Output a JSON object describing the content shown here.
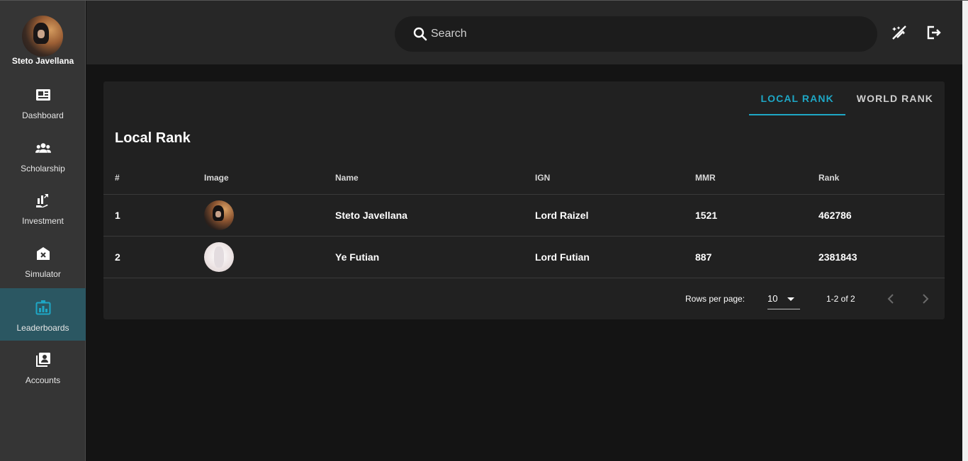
{
  "user": {
    "name": "Steto Javellana"
  },
  "sidebar": {
    "items": [
      {
        "label": "Dashboard",
        "icon": "newspaper-icon",
        "active": false
      },
      {
        "label": "Scholarship",
        "icon": "people-group-icon",
        "active": false
      },
      {
        "label": "Investment",
        "icon": "chart-hand-icon",
        "active": false
      },
      {
        "label": "Simulator",
        "icon": "house-x-icon",
        "active": false
      },
      {
        "label": "Leaderboards",
        "icon": "leaderboard-icon",
        "active": true
      },
      {
        "label": "Accounts",
        "icon": "account-box-icon",
        "active": false
      }
    ]
  },
  "topbar": {
    "search_placeholder": "Search",
    "icons": [
      "theme-toggle-icon",
      "logout-icon"
    ]
  },
  "tabs": [
    {
      "label": "LOCAL RANK",
      "active": true
    },
    {
      "label": "WORLD RANK",
      "active": false
    }
  ],
  "card": {
    "title": "Local Rank"
  },
  "table": {
    "headers": [
      "#",
      "Image",
      "Name",
      "IGN",
      "MMR",
      "Rank"
    ],
    "rows": [
      {
        "num": "1",
        "name": "Steto Javellana",
        "ign": "Lord Raizel",
        "mmr": "1521",
        "rank": "462786"
      },
      {
        "num": "2",
        "name": "Ye Futian",
        "ign": "Lord Futian",
        "mmr": "887",
        "rank": "2381843"
      }
    ]
  },
  "pagination": {
    "rows_per_page_label": "Rows per page:",
    "rows_per_page_value": "10",
    "range": "1-2 of 2"
  },
  "colors": {
    "accent": "#1ea7c5",
    "active_nav_bg": "#2b5762",
    "sidebar_bg": "#353535",
    "topbar_bg": "#272727",
    "card_bg": "#212121",
    "page_bg": "#141414"
  }
}
